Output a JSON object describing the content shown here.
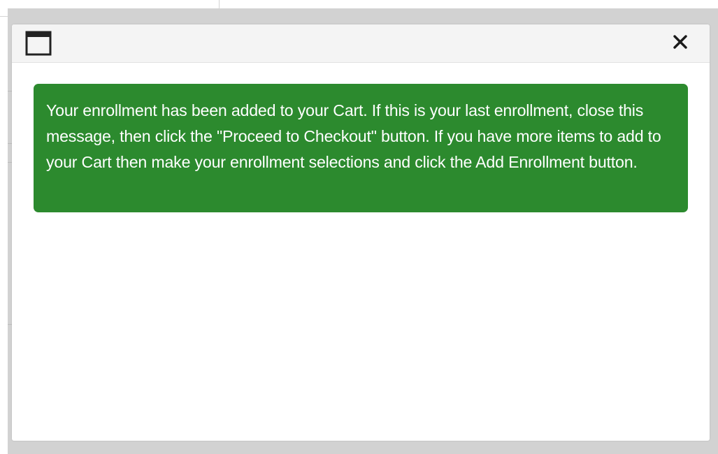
{
  "modal": {
    "icon": "window-icon",
    "close_icon": "close-icon",
    "close_glyph": "✕",
    "message": "Your enrollment has been added to your Cart. If this is your last enrollment, close this message, then click the \"Proceed to Checkout\" button. If you have more items to add to your Cart then make your enrollment selections and click the Add Enrollment button."
  },
  "colors": {
    "alert_background": "#2c8a2e",
    "alert_text": "#ffffff",
    "header_background": "#f4f4f4",
    "overlay": "#d2d2d2"
  }
}
